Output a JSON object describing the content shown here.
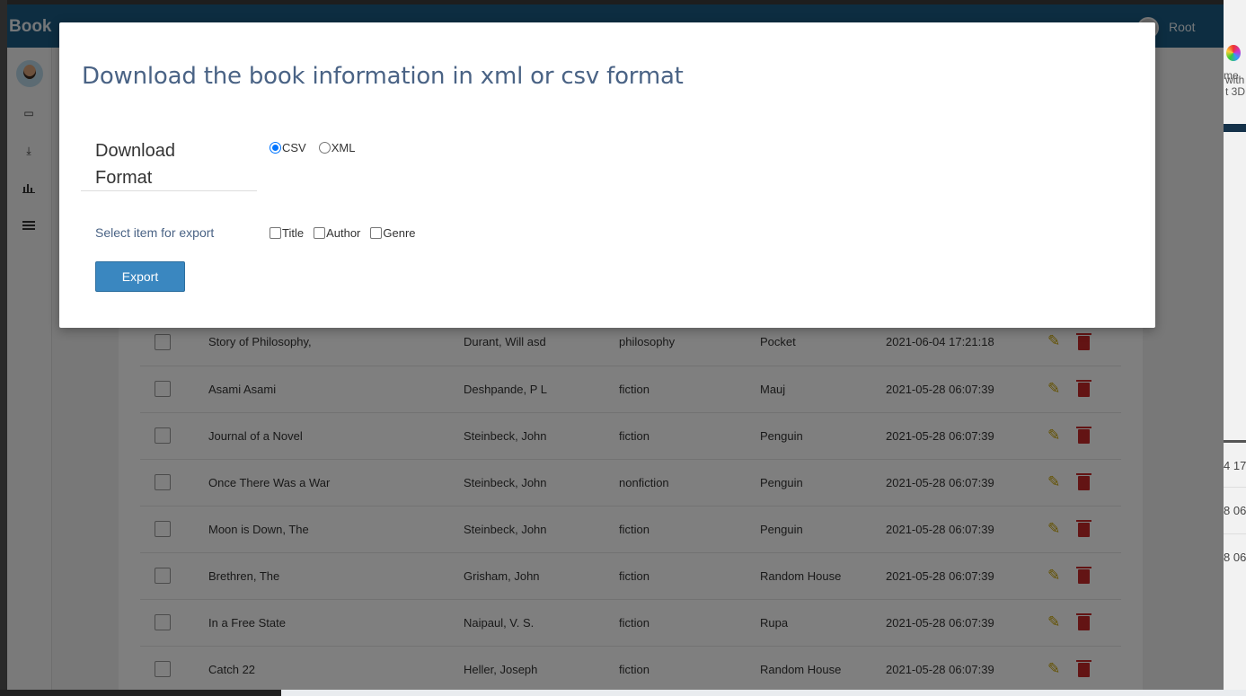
{
  "app": {
    "brand": "Book",
    "user_name": "Root"
  },
  "background_window": {
    "snippets": [
      "me",
      "with",
      "t 3D"
    ],
    "dates": [
      "4 17:",
      "8 06:",
      "8 06:"
    ]
  },
  "books": [
    {
      "title": "Story of Philosophy,",
      "author": "Durant, Will asd",
      "genre": "philosophy",
      "publisher": "Pocket",
      "date": "2021-06-04 17:21:18"
    },
    {
      "title": "Asami Asami",
      "author": "Deshpande, P L",
      "genre": "fiction",
      "publisher": "Mauj",
      "date": "2021-05-28 06:07:39"
    },
    {
      "title": "Journal of a Novel",
      "author": "Steinbeck, John",
      "genre": "fiction",
      "publisher": "Penguin",
      "date": "2021-05-28 06:07:39"
    },
    {
      "title": "Once There Was a War",
      "author": "Steinbeck, John",
      "genre": "nonfiction",
      "publisher": "Penguin",
      "date": "2021-05-28 06:07:39"
    },
    {
      "title": "Moon is Down, The",
      "author": "Steinbeck, John",
      "genre": "fiction",
      "publisher": "Penguin",
      "date": "2021-05-28 06:07:39"
    },
    {
      "title": "Brethren, The",
      "author": "Grisham, John",
      "genre": "fiction",
      "publisher": "Random House",
      "date": "2021-05-28 06:07:39"
    },
    {
      "title": "In a Free State",
      "author": "Naipaul, V. S.",
      "genre": "fiction",
      "publisher": "Rupa",
      "date": "2021-05-28 06:07:39"
    },
    {
      "title": "Catch 22",
      "author": "Heller, Joseph",
      "genre": "fiction",
      "publisher": "Random House",
      "date": "2021-05-28 06:07:39"
    }
  ],
  "modal": {
    "title": "Download the book information in xml or csv format",
    "format_label_line1": "Download",
    "format_label_line2": "Format",
    "format_options": [
      {
        "label": "CSV",
        "checked": true
      },
      {
        "label": "XML",
        "checked": false
      }
    ],
    "select_label": "Select item for export",
    "export_items": [
      {
        "label": "Title",
        "checked": false
      },
      {
        "label": "Author",
        "checked": false
      },
      {
        "label": "Genre",
        "checked": false
      }
    ],
    "export_button": "Export"
  },
  "colors": {
    "navbar": "#1b5b82",
    "modal_title": "#4a6385",
    "export_button": "#3a87c0",
    "edit_icon": "#c9a400",
    "delete_icon": "#c62828"
  },
  "icons": [
    "book-icon",
    "download-icon",
    "bar-chart-icon",
    "list-icon",
    "edit-icon",
    "trash-icon"
  ]
}
